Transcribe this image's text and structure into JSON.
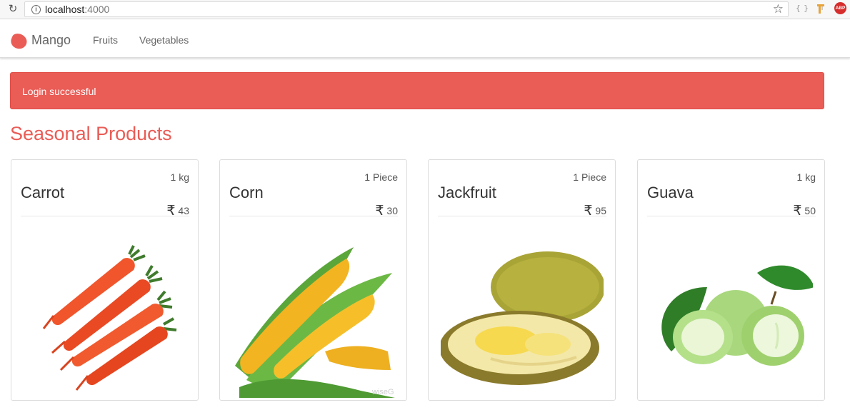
{
  "browser": {
    "url_host": "localhost",
    "url_port": ":4000",
    "abp_label": "ABP",
    "json_ext_label": "{ }"
  },
  "navbar": {
    "brand": "Mango",
    "links": [
      "Fruits",
      "Vegetables"
    ]
  },
  "alert": {
    "message": "Login successful",
    "color": "#ea5c56"
  },
  "section_title": "Seasonal Products",
  "products": [
    {
      "name": "Carrot",
      "quantity": "1 kg",
      "currency": "₹",
      "price": "43",
      "image": "carrot-image"
    },
    {
      "name": "Corn",
      "quantity": "1 Piece",
      "currency": "₹",
      "price": "30",
      "image": "corn-image",
      "watermark": "wiseG"
    },
    {
      "name": "Jackfruit",
      "quantity": "1 Piece",
      "currency": "₹",
      "price": "95",
      "image": "jackfruit-image"
    },
    {
      "name": "Guava",
      "quantity": "1 kg",
      "currency": "₹",
      "price": "50",
      "image": "guava-image"
    }
  ]
}
